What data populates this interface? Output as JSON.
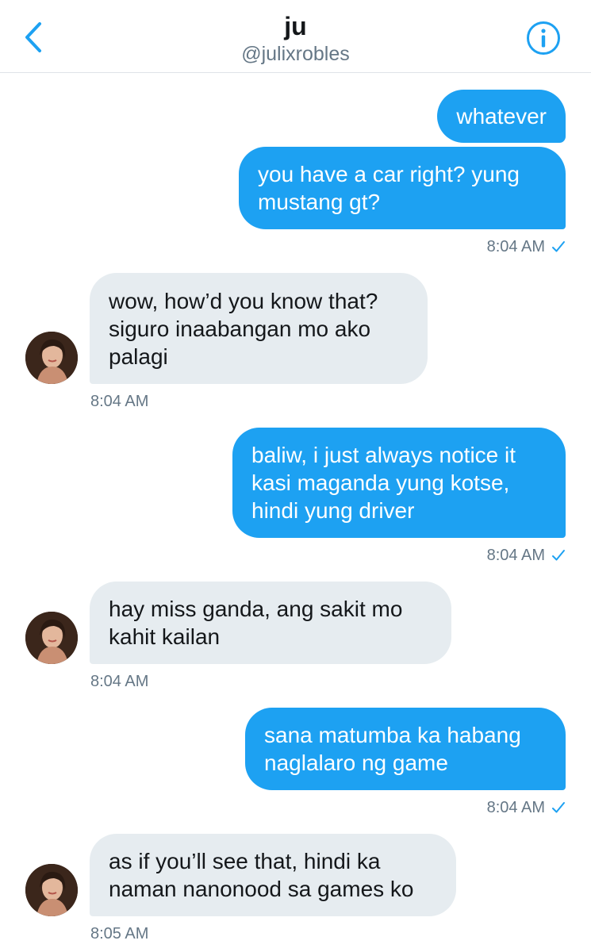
{
  "header": {
    "title": "ju",
    "handle": "@julixrobles",
    "back_icon": "chevron-left-icon",
    "info_icon": "info-circle-icon",
    "accent_color": "#1da1f2"
  },
  "messages": [
    {
      "direction": "out",
      "text": "whatever"
    },
    {
      "direction": "out",
      "text": "you have a car right? yung\nmustang gt?",
      "time": "8:04 AM",
      "status_icon": "check-icon"
    },
    {
      "direction": "in",
      "text": "wow, how’d you know that?\nsiguro inaabangan mo ako\npalagi",
      "time": "8:04 AM"
    },
    {
      "direction": "out",
      "text": "baliw, i just always notice it\nkasi maganda yung kotse,\nhindi yung driver",
      "time": "8:04 AM",
      "status_icon": "check-icon"
    },
    {
      "direction": "in",
      "text": "hay miss ganda, ang sakit mo\nkahit kailan",
      "time": "8:04 AM"
    },
    {
      "direction": "out",
      "text": "sana matumba ka habang\nnaglalaro ng game",
      "time": "8:04 AM",
      "status_icon": "check-icon"
    },
    {
      "direction": "in",
      "text": "as if you’ll see that, hindi ka\nnaman nanonood sa games ko",
      "time": "8:05 AM"
    }
  ],
  "colors": {
    "outgoing_bubble": "#1da1f2",
    "incoming_bubble": "#e6ecf0",
    "timestamp": "#657786"
  }
}
